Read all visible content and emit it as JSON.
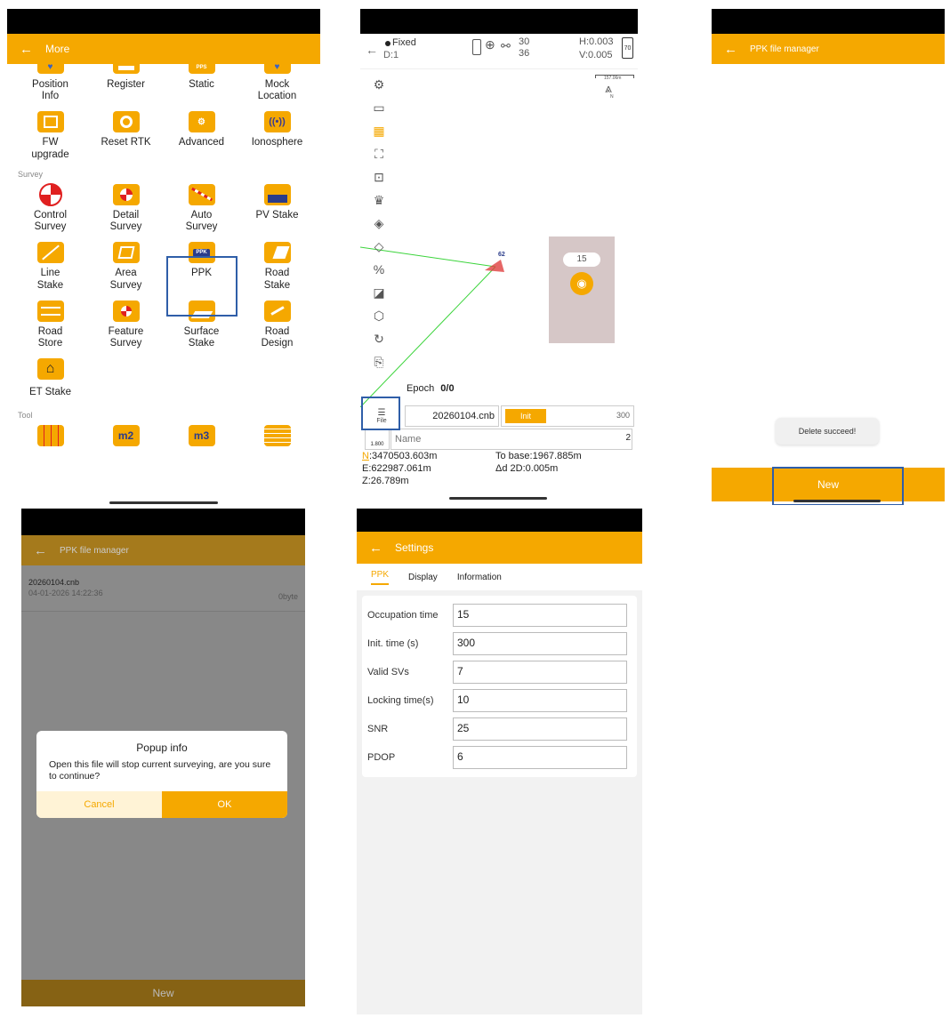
{
  "colors": {
    "accent": "#f5a800",
    "highlight": "#2f5ea8",
    "green": "#3bd43b"
  },
  "more": {
    "title": "More",
    "back_icon": "arrow-left-icon",
    "row_top": [
      {
        "label": "Position Info"
      },
      {
        "label": "Register"
      },
      {
        "label": "Static",
        "badge": "PPS"
      },
      {
        "label": "Mock Location"
      }
    ],
    "row_top2": [
      {
        "label": "FW upgrade"
      },
      {
        "label": "Reset RTK"
      },
      {
        "label": "Advanced"
      },
      {
        "label": "Ionosphere"
      }
    ],
    "survey_section": "Survey",
    "survey_rows": [
      [
        {
          "label": "Control Survey"
        },
        {
          "label": "Detail Survey"
        },
        {
          "label": "Auto Survey"
        },
        {
          "label": "PV Stake"
        }
      ],
      [
        {
          "label": "Line Stake"
        },
        {
          "label": "Area Survey"
        },
        {
          "label": "PPK",
          "badge": "PPK"
        },
        {
          "label": "Road Stake"
        }
      ],
      [
        {
          "label": "Road Store"
        },
        {
          "label": "Feature Survey"
        },
        {
          "label": "Surface Stake"
        },
        {
          "label": "Road Design"
        }
      ],
      [
        {
          "label": "ET Stake"
        }
      ]
    ],
    "tool_section": "Tool",
    "tool_badges": [
      "",
      "m2",
      "m3",
      ""
    ]
  },
  "map": {
    "status": "Fixed",
    "diff": "D:1",
    "sats_top": "30",
    "sats_bottom": "36",
    "h_prec": "H:0.003",
    "v_prec": "V:0.005",
    "battery": "70",
    "scale": "157.06m",
    "north": "N",
    "point_label": "62",
    "cluster_count": "15",
    "epoch_label": "Epoch",
    "epoch_value": "0/0",
    "file_label": "File",
    "file_name": "20260104.cnb",
    "init_button": "Init",
    "init_value": "300",
    "name_placeholder": "Name",
    "name_value": "2",
    "height_value": "1.800",
    "n_label": "N",
    "n_value": ":3470503.603m",
    "e_value": "E:622987.061m",
    "z_value": "Z:26.789m",
    "to_base": "To base:1967.885m",
    "delta_2d": "Δd 2D:0.005m"
  },
  "manager": {
    "title": "PPK file manager",
    "toast": "Delete succeed!",
    "new_button": "New"
  },
  "popup_screen": {
    "title": "PPK file manager",
    "file_name": "20260104.cnb",
    "file_date": "04-01-2026 14:22:36",
    "file_size": "0byte",
    "popup_title": "Popup info",
    "popup_message": "Open this file will stop current surveying, are you sure to continue?",
    "cancel": "Cancel",
    "ok": "OK",
    "new_button": "New"
  },
  "settings": {
    "title": "Settings",
    "tabs": [
      "PPK",
      "Display",
      "Information"
    ],
    "fields": [
      {
        "label": "Occupation time",
        "value": "15"
      },
      {
        "label": "Init. time (s)",
        "value": "300"
      },
      {
        "label": "Valid SVs",
        "value": "7"
      },
      {
        "label": "Locking time(s)",
        "value": "10"
      },
      {
        "label": "SNR",
        "value": "25"
      },
      {
        "label": "PDOP",
        "value": "6"
      }
    ]
  }
}
